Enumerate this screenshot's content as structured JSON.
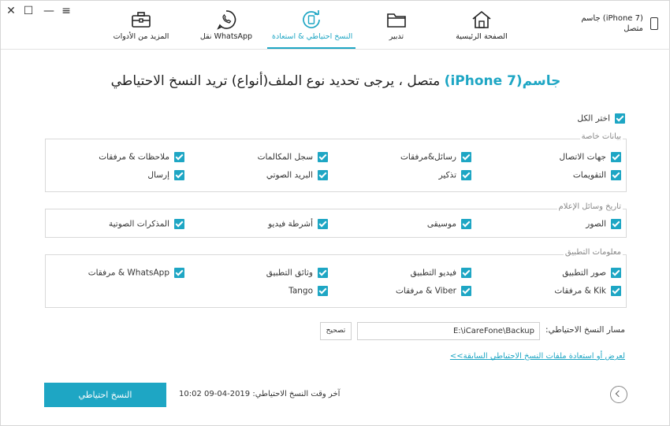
{
  "window": {
    "close_glyph": "✕",
    "maximize_glyph": "☐",
    "minimize_glyph": "—",
    "menu_glyph": "≡"
  },
  "nav": {
    "items": [
      {
        "label": "المزيد من الأدوات",
        "icon": "toolbox-icon"
      },
      {
        "label": "نقل WhatsApp",
        "icon": "whatsapp-icon"
      },
      {
        "label": "النسخ احتياطي & استعادة",
        "icon": "backup-restore-icon",
        "active": true
      },
      {
        "label": "تدبير",
        "icon": "folder-icon"
      },
      {
        "label": "الصفحة الرئيسية",
        "icon": "home-icon"
      }
    ],
    "accent_color": "#1ea6c4"
  },
  "device": {
    "name": "جاسم (iPhone 7)",
    "status": "متصل"
  },
  "headline": {
    "device_name": "جاسم(iPhone 7)",
    "rest": " متصل ، يرجى تحديد نوع الملف(أنواع) تريد النسخ الاحتياطي"
  },
  "select_all": {
    "label": "اختر الكل",
    "checked": true
  },
  "groups": [
    {
      "title": "بيانات خاصة",
      "items": [
        "جهات الاتصال",
        "رسائل&مرفقات",
        "سجل المكالمات",
        "ملاحظات & مرفقات",
        "التقويمات",
        "تذكير",
        "البريد الصوتي",
        "إرسال"
      ]
    },
    {
      "title": "تاريخ وسائل الإعلام",
      "items": [
        "الصور",
        "موسيقى",
        "أشرطة فيديو",
        "المذكرات الصوتية"
      ]
    },
    {
      "title": "معلومات التطبيق",
      "items": [
        "صور التطبيق",
        "فيديو التطبيق",
        "وثائق التطبيق",
        "WhatsApp & مرفقات",
        "Kik & مرفقات",
        "Viber & مرفقات",
        "Tango"
      ]
    }
  ],
  "backup_path": {
    "label": "مسار النسخ الاحتياطي:",
    "value": "E:\\iCareFone\\Backup",
    "browse_label": "تصحيح"
  },
  "restore_link": "لعرض أو استعادة ملفات النسخ الاحتياطي السابقة>>",
  "backup_button": "النسخ احتياطي",
  "last_backup": {
    "label": "آخر وقت النسخ الاحتياطي:",
    "value": "2019-04-09 10:02"
  }
}
